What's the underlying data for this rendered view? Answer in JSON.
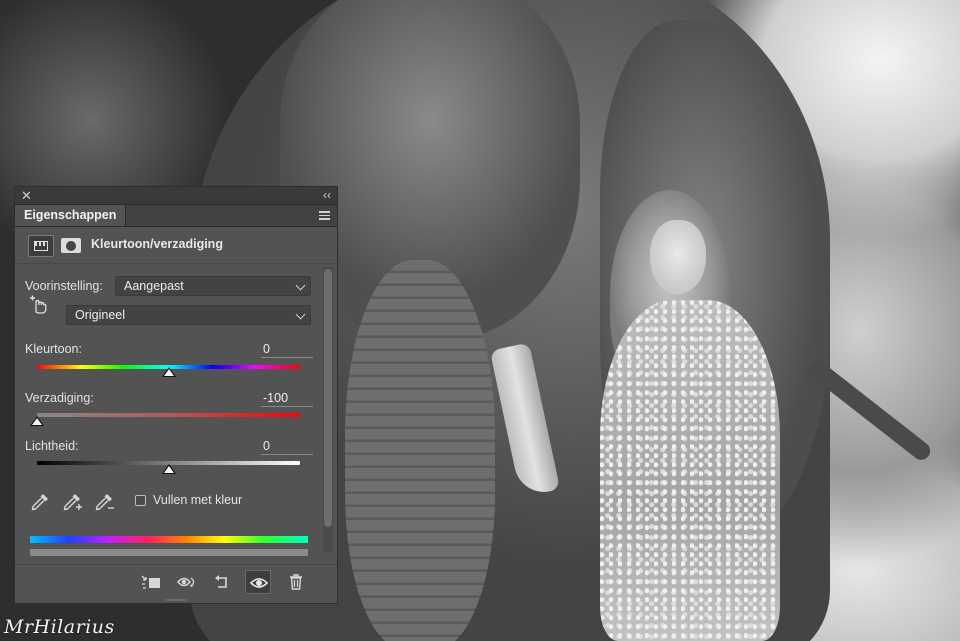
{
  "panel": {
    "tab_label": "Eigenschappen",
    "adjustment_title": "Kleurtoon/verzadiging",
    "preset_label": "Voorinstelling:",
    "preset_value": "Aangepast",
    "channel_value": "Origineel",
    "hue": {
      "label": "Kleurtoon:",
      "value": "0",
      "fraction": 0.5
    },
    "saturation": {
      "label": "Verzadiging:",
      "value": "-100",
      "fraction": 0.0
    },
    "lightness": {
      "label": "Lichtheid:",
      "value": "0",
      "fraction": 0.5
    },
    "colorize_label": "Vullen met kleur",
    "colorize_checked": false
  },
  "photo": {
    "signature": "MrHilarius"
  },
  "colors": {
    "panel_bg": "#535353",
    "panel_header": "#424242",
    "field_bg": "#434343"
  },
  "icons": {
    "close": "close-icon",
    "collapse": "double-chevron-left-icon",
    "menu": "panel-menu-icon",
    "hue_saturation": "hue-saturation-adjustment-icon",
    "mask": "layer-mask-icon",
    "on_image_adjust": "hand-pointer-icon",
    "eyedropper": "eyedropper-icon",
    "eyedropper_add": "eyedropper-plus-icon",
    "eyedropper_subtract": "eyedropper-minus-icon",
    "clip": "clip-to-layer-icon",
    "view_previous": "view-previous-state-icon",
    "reset": "reset-icon",
    "visibility": "eye-icon",
    "delete": "trash-icon"
  }
}
